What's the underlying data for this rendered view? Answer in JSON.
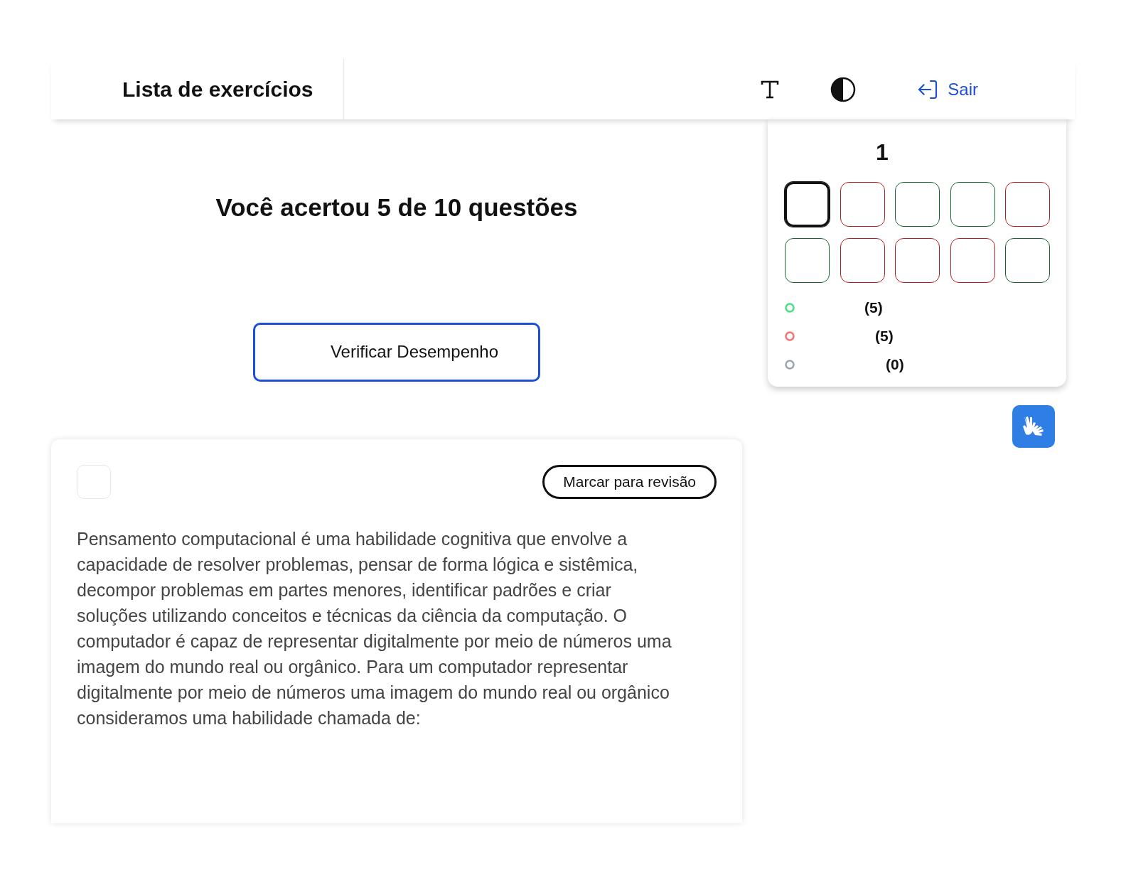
{
  "header": {
    "title": "Lista de exercícios",
    "logout_label": "Sair"
  },
  "result": {
    "heading": "Você acertou 5 de 10 questões",
    "button": "Verificar Desempenho"
  },
  "navigator": {
    "current_number": "1",
    "questions": [
      {
        "kind": "current",
        "selected": true
      },
      {
        "kind": "wrong",
        "selected": false
      },
      {
        "kind": "correct",
        "selected": false
      },
      {
        "kind": "correct",
        "selected": false
      },
      {
        "kind": "wrong",
        "selected": false
      },
      {
        "kind": "correct",
        "selected": false
      },
      {
        "kind": "wrong",
        "selected": false
      },
      {
        "kind": "wrong",
        "selected": false
      },
      {
        "kind": "wrong",
        "selected": false
      },
      {
        "kind": "correct",
        "selected": false
      }
    ],
    "legend": [
      {
        "color": "#4ade80",
        "count": "(5)"
      },
      {
        "color": "#f87171",
        "count": "(5)"
      },
      {
        "color": "#9ca3af",
        "count": "(0)"
      }
    ]
  },
  "question": {
    "checked": false,
    "review_button": "Marcar para revisão",
    "text": "Pensamento computacional é uma habilidade cognitiva que envolve a capacidade de resolver problemas, pensar de forma lógica e sistêmica, decompor problemas em partes menores, identificar padrões e criar soluções utilizando conceitos e técnicas da ciência da computação. O computador é capaz de representar digitalmente por meio de números uma imagem do mundo real ou orgânico. Para um computador representar digitalmente por meio de números uma imagem do mundo real ou orgânico consideramos uma habilidade chamada de:"
  }
}
